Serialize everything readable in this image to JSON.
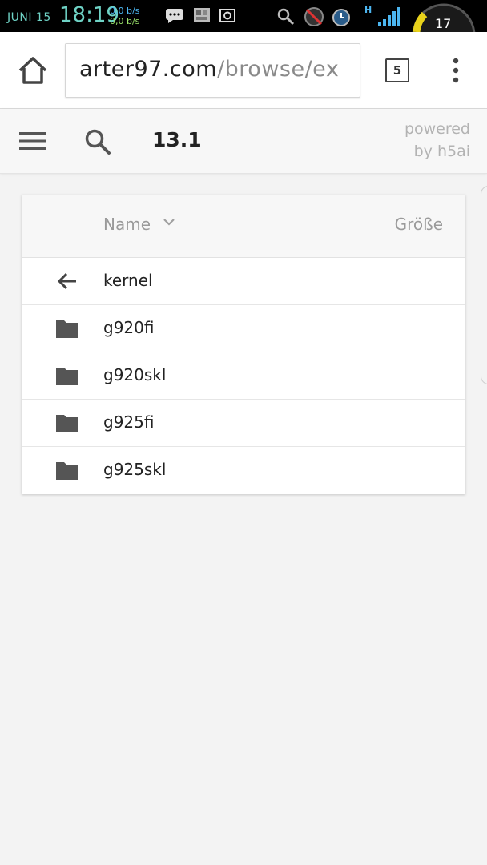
{
  "status_bar": {
    "date": "JUNI 15",
    "time": "18:19",
    "speed_up": "0,0 b/s",
    "speed_down": "0,0 b/s",
    "network_label": "H",
    "badge_count": "17"
  },
  "browser": {
    "url_host": "arter97.com",
    "url_path": "/browse/ex",
    "tab_count": "5"
  },
  "header": {
    "current_folder": "13.1",
    "powered_line1": "powered",
    "powered_line2": "by h5ai"
  },
  "list": {
    "col_name": "Name",
    "col_size": "Größe",
    "items": [
      {
        "label": "kernel",
        "icon": "back-arrow-icon"
      },
      {
        "label": "g920fi",
        "icon": "folder-icon"
      },
      {
        "label": "g920skl",
        "icon": "folder-icon"
      },
      {
        "label": "g925fi",
        "icon": "folder-icon"
      },
      {
        "label": "g925skl",
        "icon": "folder-icon"
      }
    ]
  },
  "colors": {
    "status_accent": "#6fd3c6",
    "icon_dark": "#555555"
  }
}
